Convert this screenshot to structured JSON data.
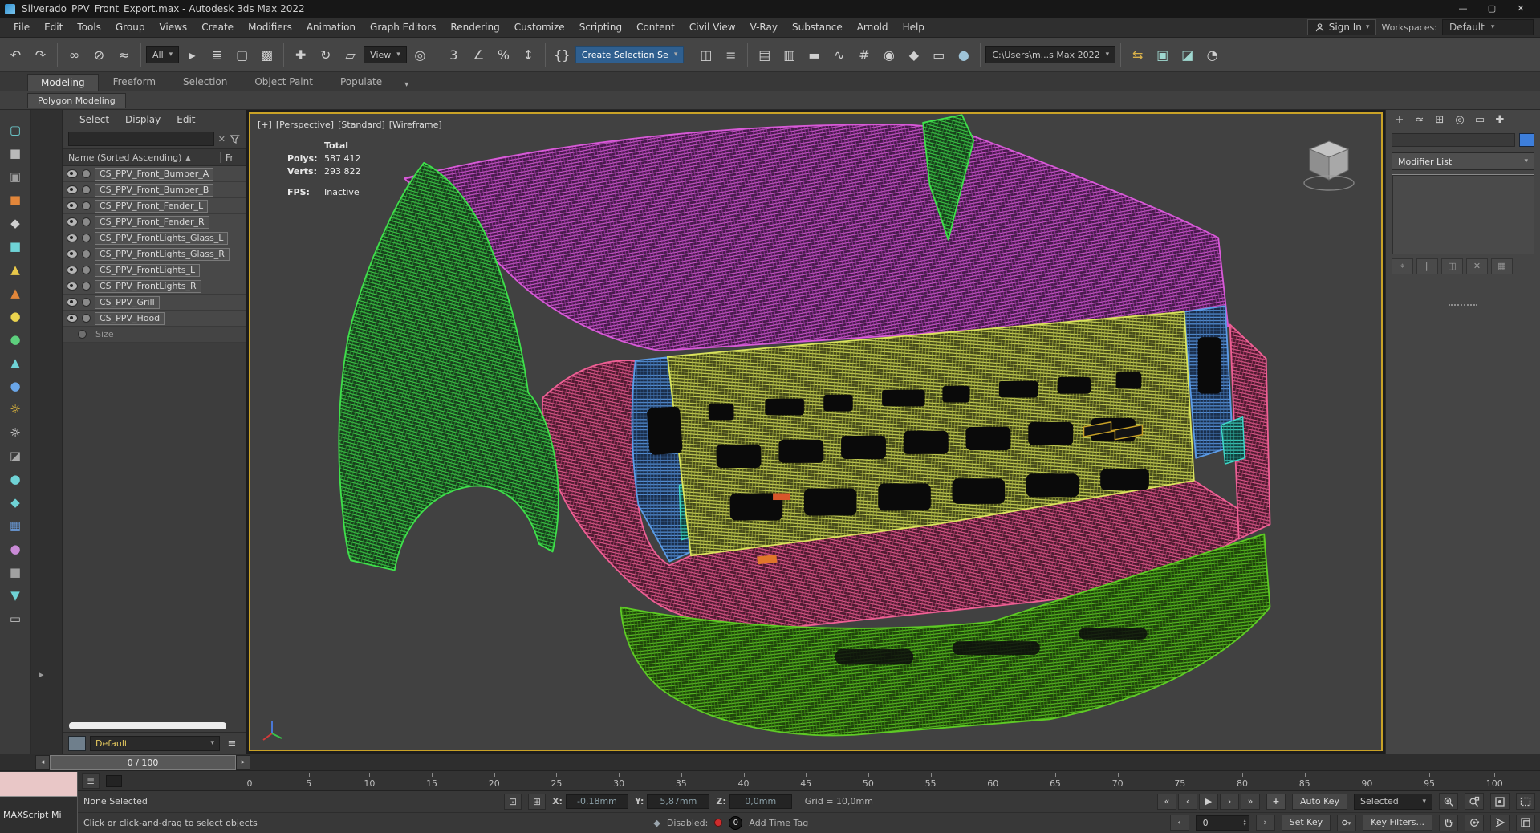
{
  "window": {
    "title": "Silverado_PPV_Front_Export.max - Autodesk 3ds Max 2022",
    "minimize": "—",
    "maximize": "▢",
    "close": "✕"
  },
  "menubar": {
    "items": [
      "File",
      "Edit",
      "Tools",
      "Group",
      "Views",
      "Create",
      "Modifiers",
      "Animation",
      "Graph Editors",
      "Rendering",
      "Customize",
      "Scripting",
      "Content",
      "Civil View",
      "V-Ray",
      "Substance",
      "Arnold",
      "Help"
    ],
    "sign_in": "Sign In",
    "workspaces_label": "Workspaces:",
    "workspace_value": "Default"
  },
  "toolbar": {
    "items": [
      {
        "kind": "icon",
        "name": "undo-icon",
        "glyph": "↶"
      },
      {
        "kind": "icon",
        "name": "redo-icon",
        "glyph": "↷"
      },
      {
        "kind": "sep"
      },
      {
        "kind": "icon",
        "name": "select-and-link-icon",
        "glyph": "∞"
      },
      {
        "kind": "icon",
        "name": "unlink-selection-icon",
        "glyph": "⊘"
      },
      {
        "kind": "icon",
        "name": "bind-to-space-warp-icon",
        "glyph": "≈"
      },
      {
        "kind": "sep"
      },
      {
        "kind": "field",
        "name": "selection-filter-dropdown",
        "text": "All",
        "arrow": true
      },
      {
        "kind": "icon",
        "name": "select-object-icon",
        "glyph": "▸"
      },
      {
        "kind": "icon",
        "name": "select-by-name-icon",
        "glyph": "≣"
      },
      {
        "kind": "icon",
        "name": "rectangular-selection-region-icon",
        "glyph": "▢"
      },
      {
        "kind": "icon",
        "name": "window-crossing-icon",
        "glyph": "▩"
      },
      {
        "kind": "sep"
      },
      {
        "kind": "icon",
        "name": "select-and-move-icon",
        "glyph": "✚"
      },
      {
        "kind": "icon",
        "name": "select-and-rotate-icon",
        "glyph": "↻"
      },
      {
        "kind": "icon",
        "name": "select-and-scale-icon",
        "glyph": "▱"
      },
      {
        "kind": "field",
        "name": "reference-coordinate-dropdown",
        "text": "View",
        "arrow": true
      },
      {
        "kind": "icon",
        "name": "use-pivot-center-icon",
        "glyph": "◎"
      },
      {
        "kind": "sep"
      },
      {
        "kind": "icon",
        "name": "snaps-toggle-icon",
        "glyph": "3"
      },
      {
        "kind": "icon",
        "name": "angle-snap-icon",
        "glyph": "∠"
      },
      {
        "kind": "icon",
        "name": "percent-snap-icon",
        "glyph": "%"
      },
      {
        "kind": "icon",
        "name": "spinner-snap-icon",
        "glyph": "↕"
      },
      {
        "kind": "sep"
      },
      {
        "kind": "icon",
        "name": "edit-named-selection-sets-icon",
        "glyph": "{}"
      },
      {
        "kind": "field",
        "name": "create-selection-set-field",
        "text": "Create Selection Se",
        "accent": true,
        "arrow": true
      },
      {
        "kind": "sep"
      },
      {
        "kind": "icon",
        "name": "mirror-icon",
        "glyph": "◫"
      },
      {
        "kind": "icon",
        "name": "align-icon",
        "glyph": "≡"
      },
      {
        "kind": "sep"
      },
      {
        "kind": "icon",
        "name": "toggle-scene-explorer-icon",
        "glyph": "▤"
      },
      {
        "kind": "icon",
        "name": "toggle-layer-explorer-icon",
        "glyph": "▥"
      },
      {
        "kind": "icon",
        "name": "toggle-ribbon-icon",
        "glyph": "▬"
      },
      {
        "kind": "icon",
        "name": "curve-editor-icon",
        "glyph": "∿"
      },
      {
        "kind": "icon",
        "name": "schematic-view-icon",
        "glyph": "#"
      },
      {
        "kind": "icon",
        "name": "material-editor-icon",
        "glyph": "◉"
      },
      {
        "kind": "icon",
        "name": "render-setup-icon",
        "glyph": "◆"
      },
      {
        "kind": "icon",
        "name": "rendered-frame-window-icon",
        "glyph": "▭"
      },
      {
        "kind": "icon",
        "name": "render-production-icon",
        "glyph": "●",
        "color": "#9fc4d8"
      },
      {
        "kind": "sep"
      },
      {
        "kind": "field",
        "name": "project-folder-field",
        "text": "C:\\Users\\m...s Max 2022",
        "arrow": true
      },
      {
        "kind": "sep"
      },
      {
        "kind": "icon",
        "name": "scene-converter-icon",
        "glyph": "⇆",
        "color": "#d8b04a"
      },
      {
        "kind": "icon",
        "name": "isolate-selection-icon",
        "glyph": "▣",
        "color": "#9fd8d0"
      },
      {
        "kind": "icon",
        "name": "display-selected-icon",
        "glyph": "◪",
        "color": "#9fd8d0"
      },
      {
        "kind": "icon",
        "name": "viewport-settings-icon",
        "glyph": "◔",
        "color": "#d0d0d0"
      }
    ]
  },
  "ribbon": {
    "tabs": [
      "Modeling",
      "Freeform",
      "Selection",
      "Object Paint",
      "Populate"
    ],
    "active": "Modeling",
    "subtab": "Polygon Modeling"
  },
  "left_toolbar": [
    {
      "name": "select-region-tool-icon",
      "glyph": "▢",
      "color": "#6fd3d6"
    },
    {
      "name": "box-primitive-icon",
      "glyph": "■",
      "color": "#b9b9b9"
    },
    {
      "name": "plane-primitive-icon",
      "glyph": "▣",
      "color": "#9f9f9f"
    },
    {
      "name": "slice-tool-icon",
      "glyph": "■",
      "color": "#e2863a"
    },
    {
      "name": "film-tool-icon",
      "glyph": "◆",
      "color": "#cfcfcf"
    },
    {
      "name": "capsule-tool-icon",
      "glyph": "■",
      "color": "#6fd3d6"
    },
    {
      "name": "cone-primitive-icon",
      "glyph": "▲",
      "color": "#e8c84a"
    },
    {
      "name": "ramp-tool-icon",
      "glyph": "▲",
      "color": "#e2863a"
    },
    {
      "name": "sphere-primitive-icon",
      "glyph": "●",
      "color": "#ead34e"
    },
    {
      "name": "torus-primitive-icon",
      "glyph": "●",
      "color": "#5dcf7d"
    },
    {
      "name": "pyramid-primitive-icon",
      "glyph": "▲",
      "color": "#6fd3d6"
    },
    {
      "name": "droplet-tool-icon",
      "glyph": "●",
      "color": "#6aa6e8"
    },
    {
      "name": "sun-light-icon",
      "glyph": "☼",
      "color": "#f2c63c"
    },
    {
      "name": "star-light-icon",
      "glyph": "☼",
      "color": "#e8e8e8"
    },
    {
      "name": "split-view-icon",
      "glyph": "◪",
      "color": "#a9a9a9"
    },
    {
      "name": "teapot-tool-icon",
      "glyph": "●",
      "color": "#6fd3d6"
    },
    {
      "name": "flask-tool-icon",
      "glyph": "◆",
      "color": "#6fd3d6"
    },
    {
      "name": "grid-helper-icon",
      "glyph": "▦",
      "color": "#6a9ad8"
    },
    {
      "name": "orb-tool-icon",
      "glyph": "●",
      "color": "#c98ad6"
    },
    {
      "name": "panel-tool-icon",
      "glyph": "■",
      "color": "#a0a0a0"
    },
    {
      "name": "prism-tool-icon",
      "glyph": "▼",
      "color": "#6fd3d6"
    },
    {
      "name": "monitor-tool-icon",
      "glyph": "▭",
      "color": "#bfbfbf"
    }
  ],
  "explorer": {
    "menus": [
      "Select",
      "Display",
      "Edit"
    ],
    "search_placeholder": "",
    "header": {
      "name_col": "Name (Sorted Ascending)",
      "sort_icon": "▲",
      "fr_col": "Fr"
    },
    "items": [
      "CS_PPV_Front_Bumper_A",
      "CS_PPV_Front_Bumper_B",
      "CS_PPV_Front_Fender_L",
      "CS_PPV_Front_Fender_R",
      "CS_PPV_FrontLights_Glass_L",
      "CS_PPV_FrontLights_Glass_R",
      "CS_PPV_FrontLights_L",
      "CS_PPV_FrontLights_R",
      "CS_PPV_Grill",
      "CS_PPV_Hood"
    ],
    "extra_item": "Size",
    "layer_name": "Default"
  },
  "viewport": {
    "label_segments": [
      "[+]",
      "[Perspective]",
      "[Standard]",
      "[Wireframe]"
    ],
    "stats": {
      "total_label": "Total",
      "polys_label": "Polys:",
      "polys": "587 412",
      "verts_label": "Verts:",
      "verts": "293 822",
      "fps_label": "FPS:",
      "fps": "Inactive"
    },
    "mesh_colors": {
      "fender_green": "#3fe04b",
      "hood_magenta": "#d85ad8",
      "grill_yellow": "#d9e35c",
      "bumper_pink": "#ee5f94",
      "headlight_blue": "#5b9be6",
      "accent_cyan": "#3fd9c9",
      "lower_green": "#5ecb25",
      "active_border": "#c9a227"
    }
  },
  "command_panel": {
    "tabs": [
      {
        "name": "create-tab-icon",
        "glyph": "+"
      },
      {
        "name": "modify-tab-icon",
        "glyph": "≈"
      },
      {
        "name": "hierarchy-tab-icon",
        "glyph": "⊞"
      },
      {
        "name": "motion-tab-icon",
        "glyph": "◎"
      },
      {
        "name": "display-tab-icon",
        "glyph": "▭"
      },
      {
        "name": "utilities-tab-icon",
        "glyph": "✚"
      }
    ],
    "modifier_list_label": "Modifier List"
  },
  "timeline": {
    "slider_label": "0 / 100",
    "ticks": [
      0,
      5,
      10,
      15,
      20,
      25,
      30,
      35,
      40,
      45,
      50,
      55,
      60,
      65,
      70,
      75,
      80,
      85,
      90,
      95,
      100
    ]
  },
  "statusbar": {
    "maxscript_label": "MAXScript Mi",
    "selection_status": "None Selected",
    "prompt": "Click or click-and-drag to select objects",
    "coords": {
      "x_label": "X:",
      "x": "-0,18mm",
      "y_label": "Y:",
      "y": "5,87mm",
      "z_label": "Z:",
      "z": "0,0mm"
    },
    "grid": "Grid = 10,0mm",
    "disabled_label": "Disabled:",
    "disabled_count": "0",
    "add_time_tag": "Add Time Tag",
    "playback": [
      {
        "name": "go-to-start-button",
        "glyph": "«"
      },
      {
        "name": "previous-frame-button",
        "glyph": "‹"
      },
      {
        "name": "play-button",
        "glyph": "▶"
      },
      {
        "name": "next-frame-button",
        "glyph": "›"
      },
      {
        "name": "go-to-end-button",
        "glyph": "»"
      }
    ],
    "auto_key": "Auto Key",
    "key_mode": "Selected",
    "set_key": "Set Key",
    "key_filters": "Key Filters...",
    "frame": "0"
  }
}
